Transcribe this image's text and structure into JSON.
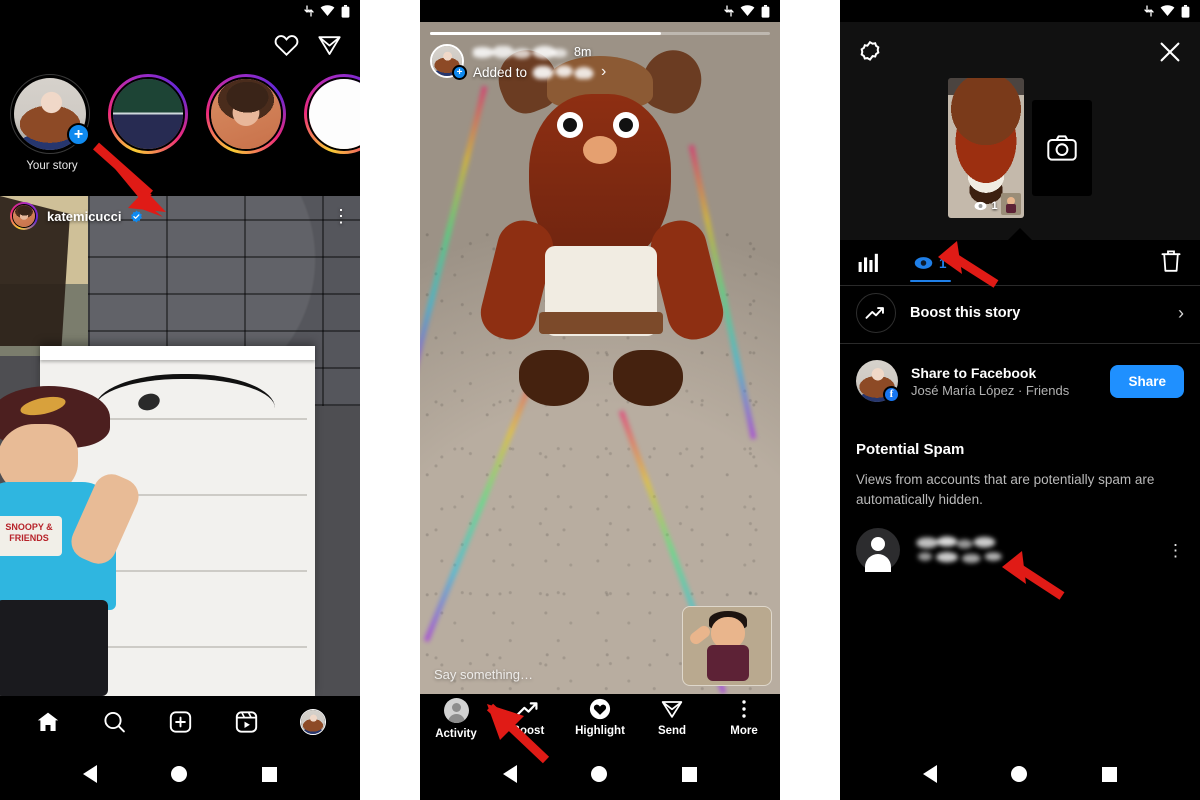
{
  "meta": {
    "accent_blue": "#1f90ff",
    "tab_blue": "#1f7fe8",
    "background": "#000000",
    "panel_bg": "#111111",
    "arrow_color": "#e01b16"
  },
  "status_bar": {
    "icons": [
      "data-transfer-icon",
      "wifi-icon",
      "battery-icon"
    ]
  },
  "android_nav": {
    "back_label": "back-triangle-icon",
    "home_label": "home-circle-icon",
    "recents_label": "recents-square-icon"
  },
  "phone1_feed": {
    "header_icons": [
      "heart-icon",
      "direct-message-icon"
    ],
    "stories": [
      {
        "label": "Your story",
        "avatar": "jose-avatar",
        "has_plus": true,
        "ring": "none"
      },
      {
        "label": "",
        "avatar": "green-gradient-avatar",
        "has_plus": false,
        "ring": "gradient"
      },
      {
        "label": "",
        "avatar": "kate-avatar",
        "has_plus": false,
        "ring": "gradient"
      },
      {
        "label": "",
        "avatar": "white-avatar",
        "has_plus": false,
        "ring": "gradient"
      }
    ],
    "post": {
      "username": "katemicucci",
      "verified": true,
      "more_icon": "more-options-icon",
      "shirt_text": "SNOOPY & FRIENDS"
    },
    "tabbar": [
      {
        "name": "home-icon",
        "label": "Home"
      },
      {
        "name": "search-icon",
        "label": "Search"
      },
      {
        "name": "create-icon",
        "label": "Create"
      },
      {
        "name": "reels-icon",
        "label": "Reels"
      },
      {
        "name": "profile-avatar",
        "label": "Profile"
      }
    ]
  },
  "phone2_story": {
    "progress_percent": 68,
    "username_redacted": true,
    "time_ago": "8m",
    "added_to_label": "Added to",
    "added_to_target_redacted": true,
    "chevron": "chevron-right-icon",
    "reply_placeholder": "Say something…",
    "pip_label": "selfie-preview",
    "actions": [
      {
        "label": "Activity",
        "icon": "activity-avatar-icon"
      },
      {
        "label": "Boost",
        "icon": "boost-trend-icon"
      },
      {
        "label": "Highlight",
        "icon": "highlight-heart-icon"
      },
      {
        "label": "Send",
        "icon": "send-paperplane-icon"
      },
      {
        "label": "More",
        "icon": "more-options-icon"
      }
    ]
  },
  "phone3_insights": {
    "top_bar": {
      "settings_icon": "story-settings-icon",
      "close_icon": "close-icon"
    },
    "thumbnails": {
      "story_views": "1",
      "view_icon": "views-eye-icon",
      "camera_icon": "camera-icon"
    },
    "tabs": [
      {
        "name": "insights-chart-tab",
        "icon": "bar-chart-icon",
        "label": "",
        "active": false
      },
      {
        "name": "viewers-tab",
        "icon": "views-eye-icon",
        "label": "1",
        "active": true
      }
    ],
    "delete_icon": "trash-icon",
    "boost_row": {
      "icon": "boost-trend-icon",
      "label": "Boost this story",
      "chevron": "chevron-right-icon"
    },
    "facebook_row": {
      "title": "Share to Facebook",
      "subtitle": "José María López · Friends",
      "button_label": "Share",
      "badge_icon": "facebook-icon"
    },
    "potential_spam": {
      "title": "Potential Spam",
      "description": "Views from accounts that are potentially spam are automatically hidden.",
      "rows": [
        {
          "avatar": "default-person-avatar",
          "username_redacted": true,
          "more_icon": "more-options-icon"
        }
      ]
    }
  },
  "annotations": {
    "arrows": [
      {
        "name": "arrow-your-story",
        "target": "Your story plus badge"
      },
      {
        "name": "arrow-activity",
        "target": "Activity button"
      },
      {
        "name": "arrow-viewers-tab",
        "target": "Viewers tab"
      },
      {
        "name": "arrow-spam-account",
        "target": "Spam account row"
      }
    ]
  }
}
